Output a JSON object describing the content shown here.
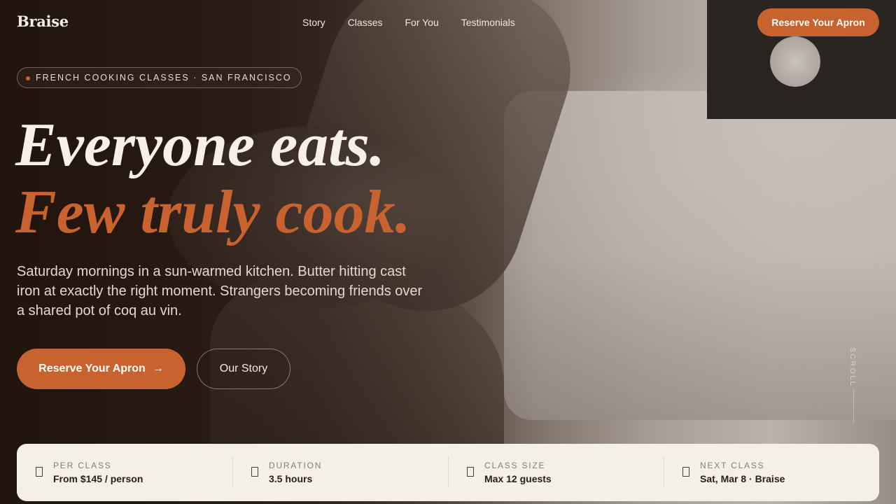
{
  "nav": {
    "brand": "Braise",
    "links": [
      "Story",
      "Classes",
      "For You",
      "Testimonials"
    ],
    "cta": "Reserve Your Apron"
  },
  "hero": {
    "eyebrow": "FRENCH COOKING CLASSES · SAN FRANCISCO",
    "headline_line1": "Everyone eats.",
    "headline_line2": "Few truly cook.",
    "lede": "Saturday mornings in a sun-warmed kitchen. Butter hitting cast iron at exactly the right moment. Strangers becoming friends over a shared pot of coq au vin.",
    "primary_cta": "Reserve Your Apron",
    "primary_cta_icon": "→",
    "secondary_cta": "Our Story",
    "scroll_label": "SCROLL"
  },
  "info": [
    {
      "label": "PER CLASS",
      "value": "From $145 / person",
      "icon": "tag-icon"
    },
    {
      "label": "DURATION",
      "value": "3.5 hours",
      "icon": "clock-icon"
    },
    {
      "label": "CLASS SIZE",
      "value": "Max 12 guests",
      "icon": "users-icon"
    },
    {
      "label": "NEXT CLASS",
      "value": "Sat, Mar 8 · Braise",
      "icon": "calendar-icon"
    }
  ],
  "colors": {
    "accent": "#c8622f",
    "cream": "#f4efe8",
    "dark": "#2a1e17"
  }
}
